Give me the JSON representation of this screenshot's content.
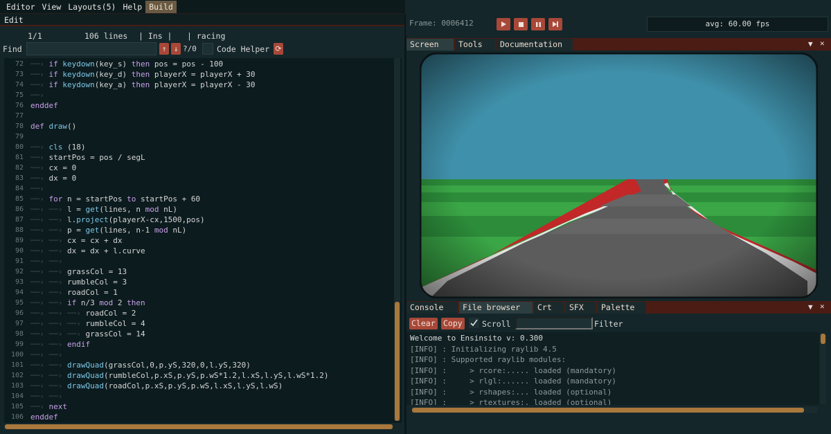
{
  "menu": {
    "items": [
      "Editor",
      "View",
      "Layouts(5)",
      "Help",
      "Build"
    ],
    "active_index": 4,
    "edit_label": "Edit"
  },
  "status": {
    "pos": "1/1",
    "lines": "106 lines",
    "mode": "| Ins |",
    "file": "| racing"
  },
  "find": {
    "label": "Find",
    "value": "",
    "count": "?/0",
    "code_helper": "Code Helper"
  },
  "code": {
    "lines": [
      {
        "n": "72",
        "t": 1,
        "c": [
          [
            "kw",
            "if "
          ],
          [
            "fn",
            "keydown"
          ],
          [
            "",
            "(key_s) "
          ],
          [
            "kw",
            "then"
          ],
          [
            "",
            " pos = pos - 100"
          ]
        ]
      },
      {
        "n": "73",
        "t": 1,
        "c": [
          [
            "kw",
            "if "
          ],
          [
            "fn",
            "keydown"
          ],
          [
            "",
            "(key_d) "
          ],
          [
            "kw",
            "then"
          ],
          [
            "",
            " playerX = playerX + 30"
          ]
        ]
      },
      {
        "n": "74",
        "t": 1,
        "c": [
          [
            "kw",
            "if "
          ],
          [
            "fn",
            "keydown"
          ],
          [
            "",
            "(key_a) "
          ],
          [
            "kw",
            "then"
          ],
          [
            "",
            " playerX = playerX - 30"
          ]
        ]
      },
      {
        "n": "75",
        "t": 1,
        "c": []
      },
      {
        "n": "76",
        "t": 0,
        "c": [
          [
            "kw",
            "enddef"
          ]
        ]
      },
      {
        "n": "77",
        "t": 0,
        "c": []
      },
      {
        "n": "78",
        "t": 0,
        "c": [
          [
            "kw",
            "def "
          ],
          [
            "fn",
            "draw"
          ],
          [
            "",
            "()"
          ]
        ]
      },
      {
        "n": "79",
        "t": 0,
        "c": []
      },
      {
        "n": "80",
        "t": 1,
        "c": [
          [
            "fn",
            "cls"
          ],
          [
            "",
            " (18)"
          ]
        ]
      },
      {
        "n": "81",
        "t": 1,
        "c": [
          [
            "",
            "startPos = pos / segL"
          ]
        ]
      },
      {
        "n": "82",
        "t": 1,
        "c": [
          [
            "",
            "cx = 0"
          ]
        ]
      },
      {
        "n": "83",
        "t": 1,
        "c": [
          [
            "",
            "dx = 0"
          ]
        ]
      },
      {
        "n": "84",
        "t": 1,
        "c": []
      },
      {
        "n": "85",
        "t": 1,
        "c": [
          [
            "kw",
            "for"
          ],
          [
            "",
            " n = startPos "
          ],
          [
            "kw",
            "to"
          ],
          [
            "",
            " startPos + 60"
          ]
        ]
      },
      {
        "n": "86",
        "t": 2,
        "c": [
          [
            "",
            "l = "
          ],
          [
            "fn",
            "get"
          ],
          [
            "",
            "(lines, n "
          ],
          [
            "kw",
            "mod"
          ],
          [
            "",
            " nL)"
          ]
        ]
      },
      {
        "n": "87",
        "t": 2,
        "c": [
          [
            "",
            "l."
          ],
          [
            "fn",
            "project"
          ],
          [
            "",
            "(playerX-cx,1500,pos)"
          ]
        ]
      },
      {
        "n": "88",
        "t": 2,
        "c": [
          [
            "",
            "p = "
          ],
          [
            "fn",
            "get"
          ],
          [
            "",
            "(lines, n-1 "
          ],
          [
            "kw",
            "mod"
          ],
          [
            "",
            " nL)"
          ]
        ]
      },
      {
        "n": "89",
        "t": 2,
        "c": [
          [
            "",
            "cx = cx + dx"
          ]
        ]
      },
      {
        "n": "90",
        "t": 2,
        "c": [
          [
            "",
            "dx = dx + l.curve"
          ]
        ]
      },
      {
        "n": "91",
        "t": 2,
        "c": []
      },
      {
        "n": "92",
        "t": 2,
        "c": [
          [
            "",
            "grassCol = 13"
          ]
        ]
      },
      {
        "n": "93",
        "t": 2,
        "c": [
          [
            "",
            "rumbleCol = 3"
          ]
        ]
      },
      {
        "n": "94",
        "t": 2,
        "c": [
          [
            "",
            "roadCol = 1"
          ]
        ]
      },
      {
        "n": "95",
        "t": 2,
        "c": [
          [
            "kw",
            "if"
          ],
          [
            "",
            " n/3 "
          ],
          [
            "kw",
            "mod"
          ],
          [
            "",
            " 2 "
          ],
          [
            "kw",
            "then"
          ]
        ]
      },
      {
        "n": "96",
        "t": 3,
        "c": [
          [
            "",
            "roadCol = 2"
          ]
        ]
      },
      {
        "n": "97",
        "t": 3,
        "c": [
          [
            "",
            "rumbleCol = 4"
          ]
        ]
      },
      {
        "n": "98",
        "t": 3,
        "c": [
          [
            "",
            "grassCol = 14"
          ]
        ]
      },
      {
        "n": "99",
        "t": 2,
        "c": [
          [
            "kw",
            "endif"
          ]
        ]
      },
      {
        "n": "100",
        "t": 2,
        "c": []
      },
      {
        "n": "101",
        "t": 2,
        "c": [
          [
            "fn",
            "drawQuad"
          ],
          [
            "",
            "(grassCol,0,p.yS,320,0,l.yS,320)"
          ]
        ]
      },
      {
        "n": "102",
        "t": 2,
        "c": [
          [
            "fn",
            "drawQuad"
          ],
          [
            "",
            "(rumbleCol,p.xS,p.yS,p.wS*1.2,l.xS,l.yS,l.wS*1.2)"
          ]
        ]
      },
      {
        "n": "103",
        "t": 2,
        "c": [
          [
            "fn",
            "drawQuad"
          ],
          [
            "",
            "(roadCol,p.xS,p.yS,p.wS,l.xS,l.yS,l.wS)"
          ]
        ]
      },
      {
        "n": "104",
        "t": 2,
        "c": []
      },
      {
        "n": "105",
        "t": 1,
        "c": [
          [
            "kw",
            "next"
          ]
        ]
      },
      {
        "n": "106",
        "t": 0,
        "c": [
          [
            "kw",
            "enddef"
          ]
        ]
      }
    ]
  },
  "frame": {
    "label": "Frame:",
    "value": "0006412",
    "fps": "avg: 60.00 fps"
  },
  "screen_tabs": [
    "Screen",
    "Tools",
    "Documentation"
  ],
  "console_tabs": [
    "Console",
    "File browser",
    "Crt",
    "SFX",
    "Palette"
  ],
  "console": {
    "clear": "Clear",
    "copy": "Copy",
    "scroll": "Scroll",
    "filter": "Filter",
    "filter_value": "",
    "lines": [
      "Welcome to Ensinsito v: 0.300",
      "[INFO] : Initializing raylib 4.5",
      "[INFO] : Supported raylib modules:",
      "[INFO] :     > rcore:..... loaded (mandatory)",
      "[INFO] :     > rlgl:...... loaded (mandatory)",
      "[INFO] :     > rshapes:... loaded (optional)",
      "[INFO] :     > rtextures:. loaded (optional)"
    ]
  },
  "colors": {
    "accent": "#a84838",
    "scroll_thumb": "#a8783c",
    "sky": "#3f90aa",
    "grass": "#2c8c3a",
    "road": "#5c5c5c",
    "rumble": "#c22828"
  },
  "icons": {
    "find_prev": "arrow-up-icon",
    "find_next": "arrow-down-icon",
    "refresh": "refresh-icon",
    "play": "play-icon",
    "stop": "stop-icon",
    "pause": "pause-icon",
    "step": "step-icon",
    "panel_menu": "triangle-menu-icon",
    "panel_close": "close-icon",
    "check": "check-icon"
  }
}
